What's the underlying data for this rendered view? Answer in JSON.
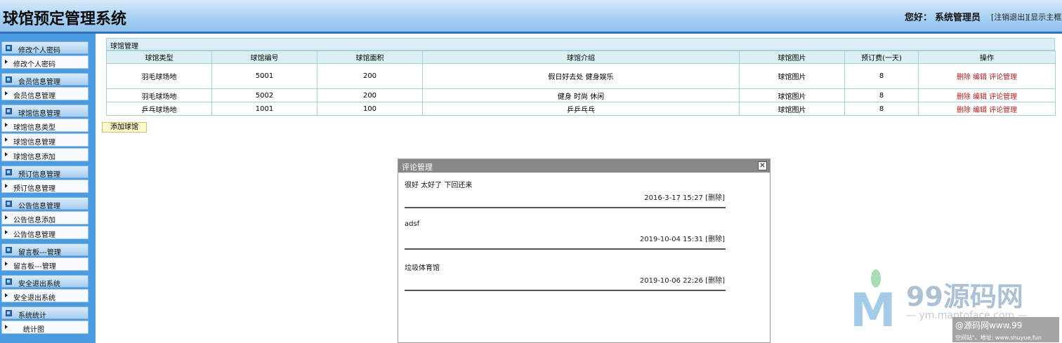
{
  "header": {
    "title": "球馆预定管理系统",
    "greeting_label": "您好：",
    "user_role": "系统管理员",
    "logout_link": "[注销退出]",
    "toggle_link": "[显示主框架]"
  },
  "sidebar": {
    "groups": [
      {
        "title": "修改个人密码",
        "items": [
          "修改个人密码"
        ]
      },
      {
        "title": "会员信息管理",
        "items": [
          "会员信息管理"
        ]
      },
      {
        "title": "球馆信息管理",
        "items": [
          "球馆信息类型",
          "球馆信息管理",
          "球馆信息添加"
        ]
      },
      {
        "title": "预订信息管理",
        "items": [
          "预订信息管理"
        ]
      },
      {
        "title": "公告信息管理",
        "items": [
          "公告信息添加",
          "公告信息管理"
        ]
      },
      {
        "title": "留言板---管理",
        "items": [
          "留言板---管理"
        ]
      },
      {
        "title": "安全退出系统",
        "items": [
          "安全退出系统"
        ]
      },
      {
        "title": "系统统计",
        "items": [
          "统计图"
        ]
      }
    ]
  },
  "panel": {
    "title": "球馆管理",
    "columns": [
      "球馆类型",
      "球馆编号",
      "球馆面积",
      "球馆介绍",
      "球馆图片",
      "预订费(一天)",
      "操作"
    ],
    "rows": [
      {
        "type": "羽毛球场地",
        "number": "5001",
        "area": "200",
        "intro": "假日好去处 健身娱乐",
        "image": "球馆图片",
        "fee": "8"
      },
      {
        "type": "羽毛球场地",
        "number": "5002",
        "area": "200",
        "intro": "健身 时尚 休闲",
        "image": "球馆图片",
        "fee": "8"
      },
      {
        "type": "乒乓球场地",
        "number": "1001",
        "area": "100",
        "intro": "乒乒乓乓",
        "image": "球馆图片",
        "fee": "8"
      }
    ],
    "actions": {
      "delete": "删除",
      "edit": "编辑",
      "comments": "评论管理"
    },
    "add_button": "添加球馆"
  },
  "dialog": {
    "title": "评论管理",
    "close": "✕",
    "delete_label": "[删除]",
    "comments": [
      {
        "text": "很好 太好了 下回还来",
        "time": "2016-3-17 15:27"
      },
      {
        "text": "adsf",
        "time": "2019-10-04 15:31"
      },
      {
        "text": "垃圾体育馆",
        "time": "2019-10-06 22:26"
      }
    ]
  },
  "watermark": {
    "brand": "99源码网",
    "url": "— ym.maptoface.com —",
    "line1": "@源码网www.99",
    "line2": "空间站\"。地址: www.shuyue.fun"
  }
}
